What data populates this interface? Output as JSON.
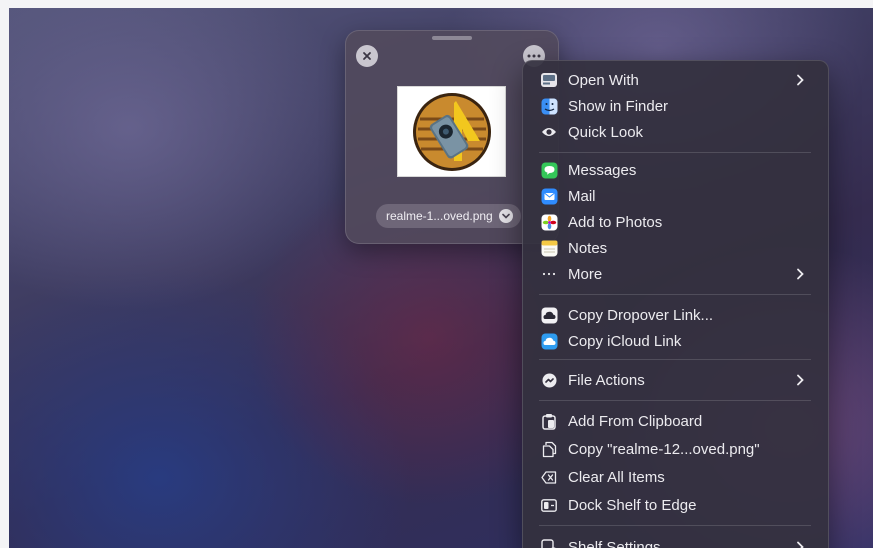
{
  "shelf": {
    "file_name": "realme-1...oved.png"
  },
  "menu": {
    "groups": [
      {
        "items": [
          {
            "label": "Open With",
            "icon": "open-with-icon",
            "submenu": true
          },
          {
            "label": "Show in Finder",
            "icon": "finder-icon",
            "submenu": false
          },
          {
            "label": "Quick Look",
            "icon": "eye-icon",
            "submenu": false
          }
        ]
      },
      {
        "items": [
          {
            "label": "Messages",
            "icon": "messages-icon",
            "submenu": false
          },
          {
            "label": "Mail",
            "icon": "mail-icon",
            "submenu": false
          },
          {
            "label": "Add to Photos",
            "icon": "photos-icon",
            "submenu": false
          },
          {
            "label": "Notes",
            "icon": "notes-icon",
            "submenu": false
          },
          {
            "label": "More",
            "icon": "ellipsis-icon",
            "submenu": true
          }
        ]
      },
      {
        "items": [
          {
            "label": "Copy Dropover Link...",
            "icon": "dropover-cloud-icon",
            "submenu": false
          },
          {
            "label": "Copy iCloud Link",
            "icon": "icloud-icon",
            "submenu": false
          }
        ]
      },
      {
        "items": [
          {
            "label": "File Actions",
            "icon": "file-actions-icon",
            "submenu": true
          }
        ]
      },
      {
        "items": [
          {
            "label": "Add From Clipboard",
            "icon": "clipboard-add-icon",
            "submenu": false
          },
          {
            "label": "Copy \"realme-12...oved.png\"",
            "icon": "copy-icon",
            "submenu": false
          },
          {
            "label": "Clear All Items",
            "icon": "clear-icon",
            "submenu": false
          },
          {
            "label": "Dock Shelf to Edge",
            "icon": "dock-edge-icon",
            "submenu": false
          }
        ]
      },
      {
        "items": [
          {
            "label": "Shelf Settings",
            "icon": "shelf-settings-icon",
            "submenu": true
          }
        ]
      }
    ]
  },
  "colors": {
    "messages": "#34c759",
    "mail": "#2f8cff",
    "finder": "#3a8ff5",
    "icloud": "#2e9cf0",
    "notes": "#f5c945"
  }
}
